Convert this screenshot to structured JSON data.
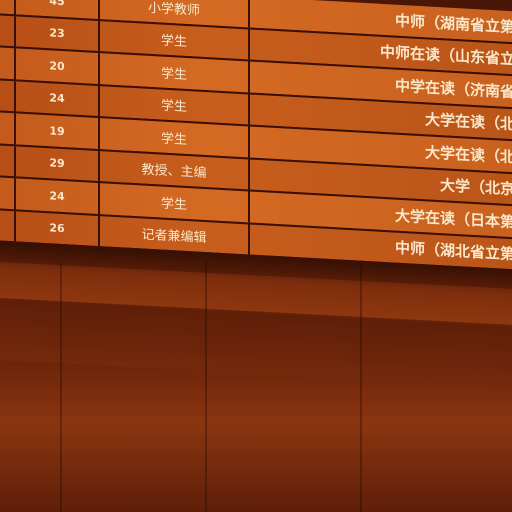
{
  "rows": [
    {
      "age": "45",
      "role": "小学教师",
      "education": "中师（湖南省立第一"
    },
    {
      "age": "23",
      "role": "学生",
      "education": "中师在读（山东省立第"
    },
    {
      "age": "20",
      "role": "学生",
      "education": "中学在读（济南省立"
    },
    {
      "age": "24",
      "role": "学生",
      "education": "大学在读（北京"
    },
    {
      "age": "19",
      "role": "学生",
      "education": "大学在读（北京"
    },
    {
      "age": "29",
      "role": "教授、主编",
      "education": "大学（北京大"
    },
    {
      "age": "24",
      "role": "学生",
      "education": "大学在读（日本第一"
    },
    {
      "age": "26",
      "role": "记者兼编辑",
      "education": "中师（湖北省立第一"
    }
  ],
  "colors": {
    "cell_light": "#d46a22",
    "cell_dark": "#b54d16",
    "grid_line": "#3a1005",
    "text": "#fbe7c8"
  }
}
